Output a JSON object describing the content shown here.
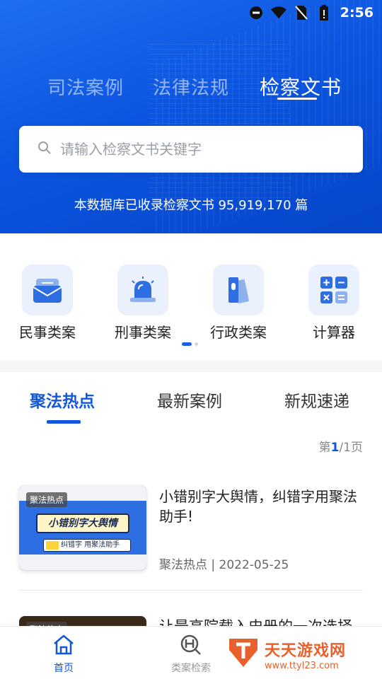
{
  "status_bar": {
    "time": "2:56"
  },
  "top_tabs": [
    {
      "label": "司法案例",
      "active": false
    },
    {
      "label": "法律法规",
      "active": false
    },
    {
      "label": "检察文书",
      "active": true
    }
  ],
  "search": {
    "placeholder": "请输入检察文书关键字"
  },
  "db_info": "本数据库已收录检察文书  95,919,170  篇",
  "features": [
    {
      "label": "民事类案",
      "icon": "mail-icon"
    },
    {
      "label": "刑事类案",
      "icon": "siren-icon"
    },
    {
      "label": "行政类案",
      "icon": "document-icon"
    },
    {
      "label": "计算器",
      "icon": "calculator-icon"
    }
  ],
  "section_tabs": [
    {
      "label": "聚法热点",
      "active": true
    },
    {
      "label": "最新案例",
      "active": false
    },
    {
      "label": "新规速递",
      "active": false
    }
  ],
  "pager": {
    "prefix": "第",
    "current": "1",
    "suffix": "/1页"
  },
  "articles": [
    {
      "badge": "聚法热点",
      "thumb_banner": "小错别字大舆情",
      "thumb_sub": "纠错字  用聚法助手",
      "title": "小错别字大舆情，纠错字用聚法助手!",
      "meta": "聚法热点 | 2022-05-25"
    },
    {
      "badge": "聚法热点",
      "title": "让最高院载入史册的一次选择"
    }
  ],
  "bottom_nav": [
    {
      "label": "首页",
      "active": true
    },
    {
      "label": "类案检索",
      "active": false
    }
  ],
  "watermark": {
    "title": "天天游戏网",
    "url": "www.ttyl23.com"
  },
  "colors": {
    "primary": "#1456d9",
    "hero": "#0c55e0"
  }
}
